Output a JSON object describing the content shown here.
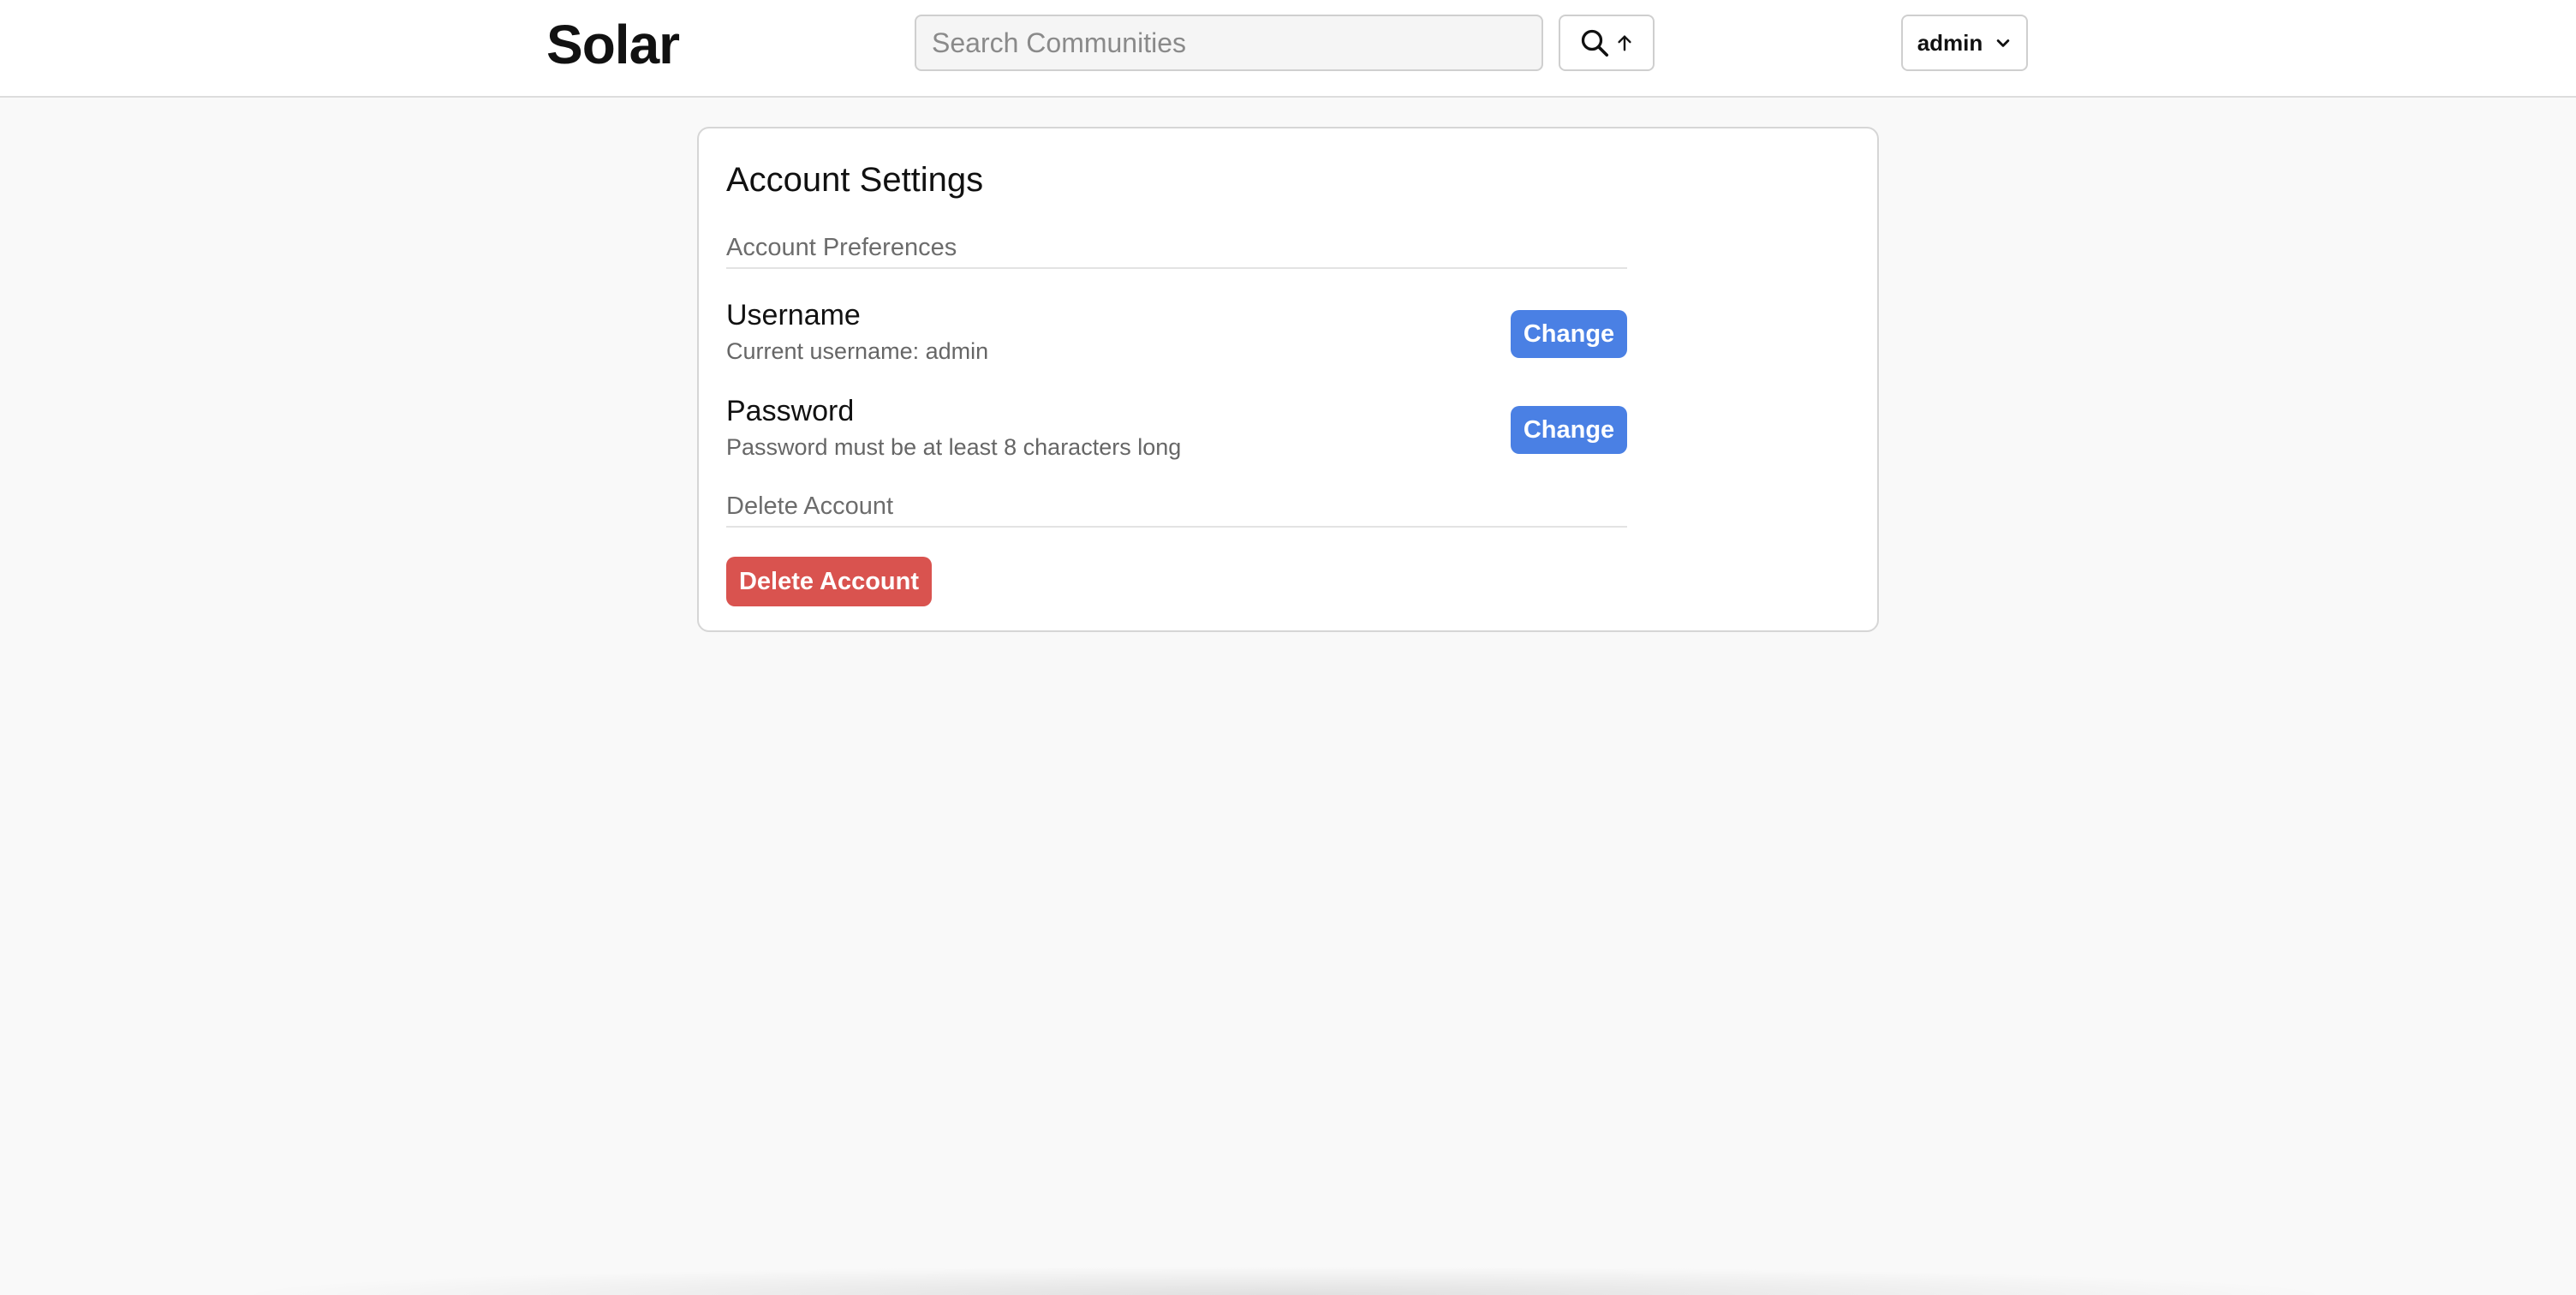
{
  "header": {
    "logo": "Solar",
    "search": {
      "placeholder": "Search Communities",
      "value": ""
    },
    "search_button_icons": [
      "search-icon",
      "arrow-up-icon"
    ],
    "user_menu": {
      "label": "admin",
      "icon": "chevron-down-icon"
    }
  },
  "settings": {
    "title": "Account Settings",
    "preferences_heading": "Account Preferences",
    "username": {
      "title": "Username",
      "description": "Current username: admin",
      "button_label": "Change"
    },
    "password": {
      "title": "Password",
      "description": "Password must be at least 8 characters long",
      "button_label": "Change"
    },
    "delete_heading": "Delete Account",
    "delete_button_label": "Delete Account"
  },
  "colors": {
    "primary": "#4a80e4",
    "danger": "#d9534f",
    "background": "#f9f9f9"
  }
}
